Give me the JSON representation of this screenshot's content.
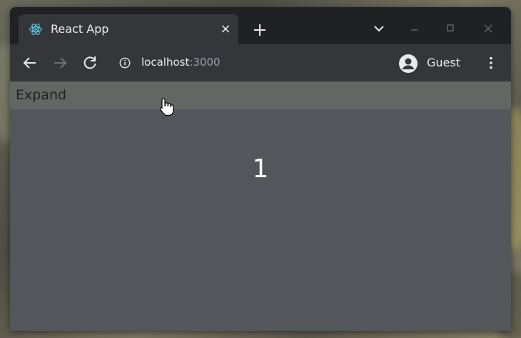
{
  "browser": {
    "tab": {
      "title": "React App",
      "favicon": "react-logo-icon",
      "close": "×"
    },
    "new_tab": "+",
    "address": {
      "host": "localhost",
      "port": ":3000"
    },
    "profile": {
      "name": "Guest"
    }
  },
  "page": {
    "expand_label": "Expand",
    "counter": "1"
  },
  "colors": {
    "titlebar": "#202124",
    "toolbar": "#35363a",
    "page_bg": "#53565b",
    "expand_bar": "#636763",
    "react_blue": "#61dafb"
  }
}
